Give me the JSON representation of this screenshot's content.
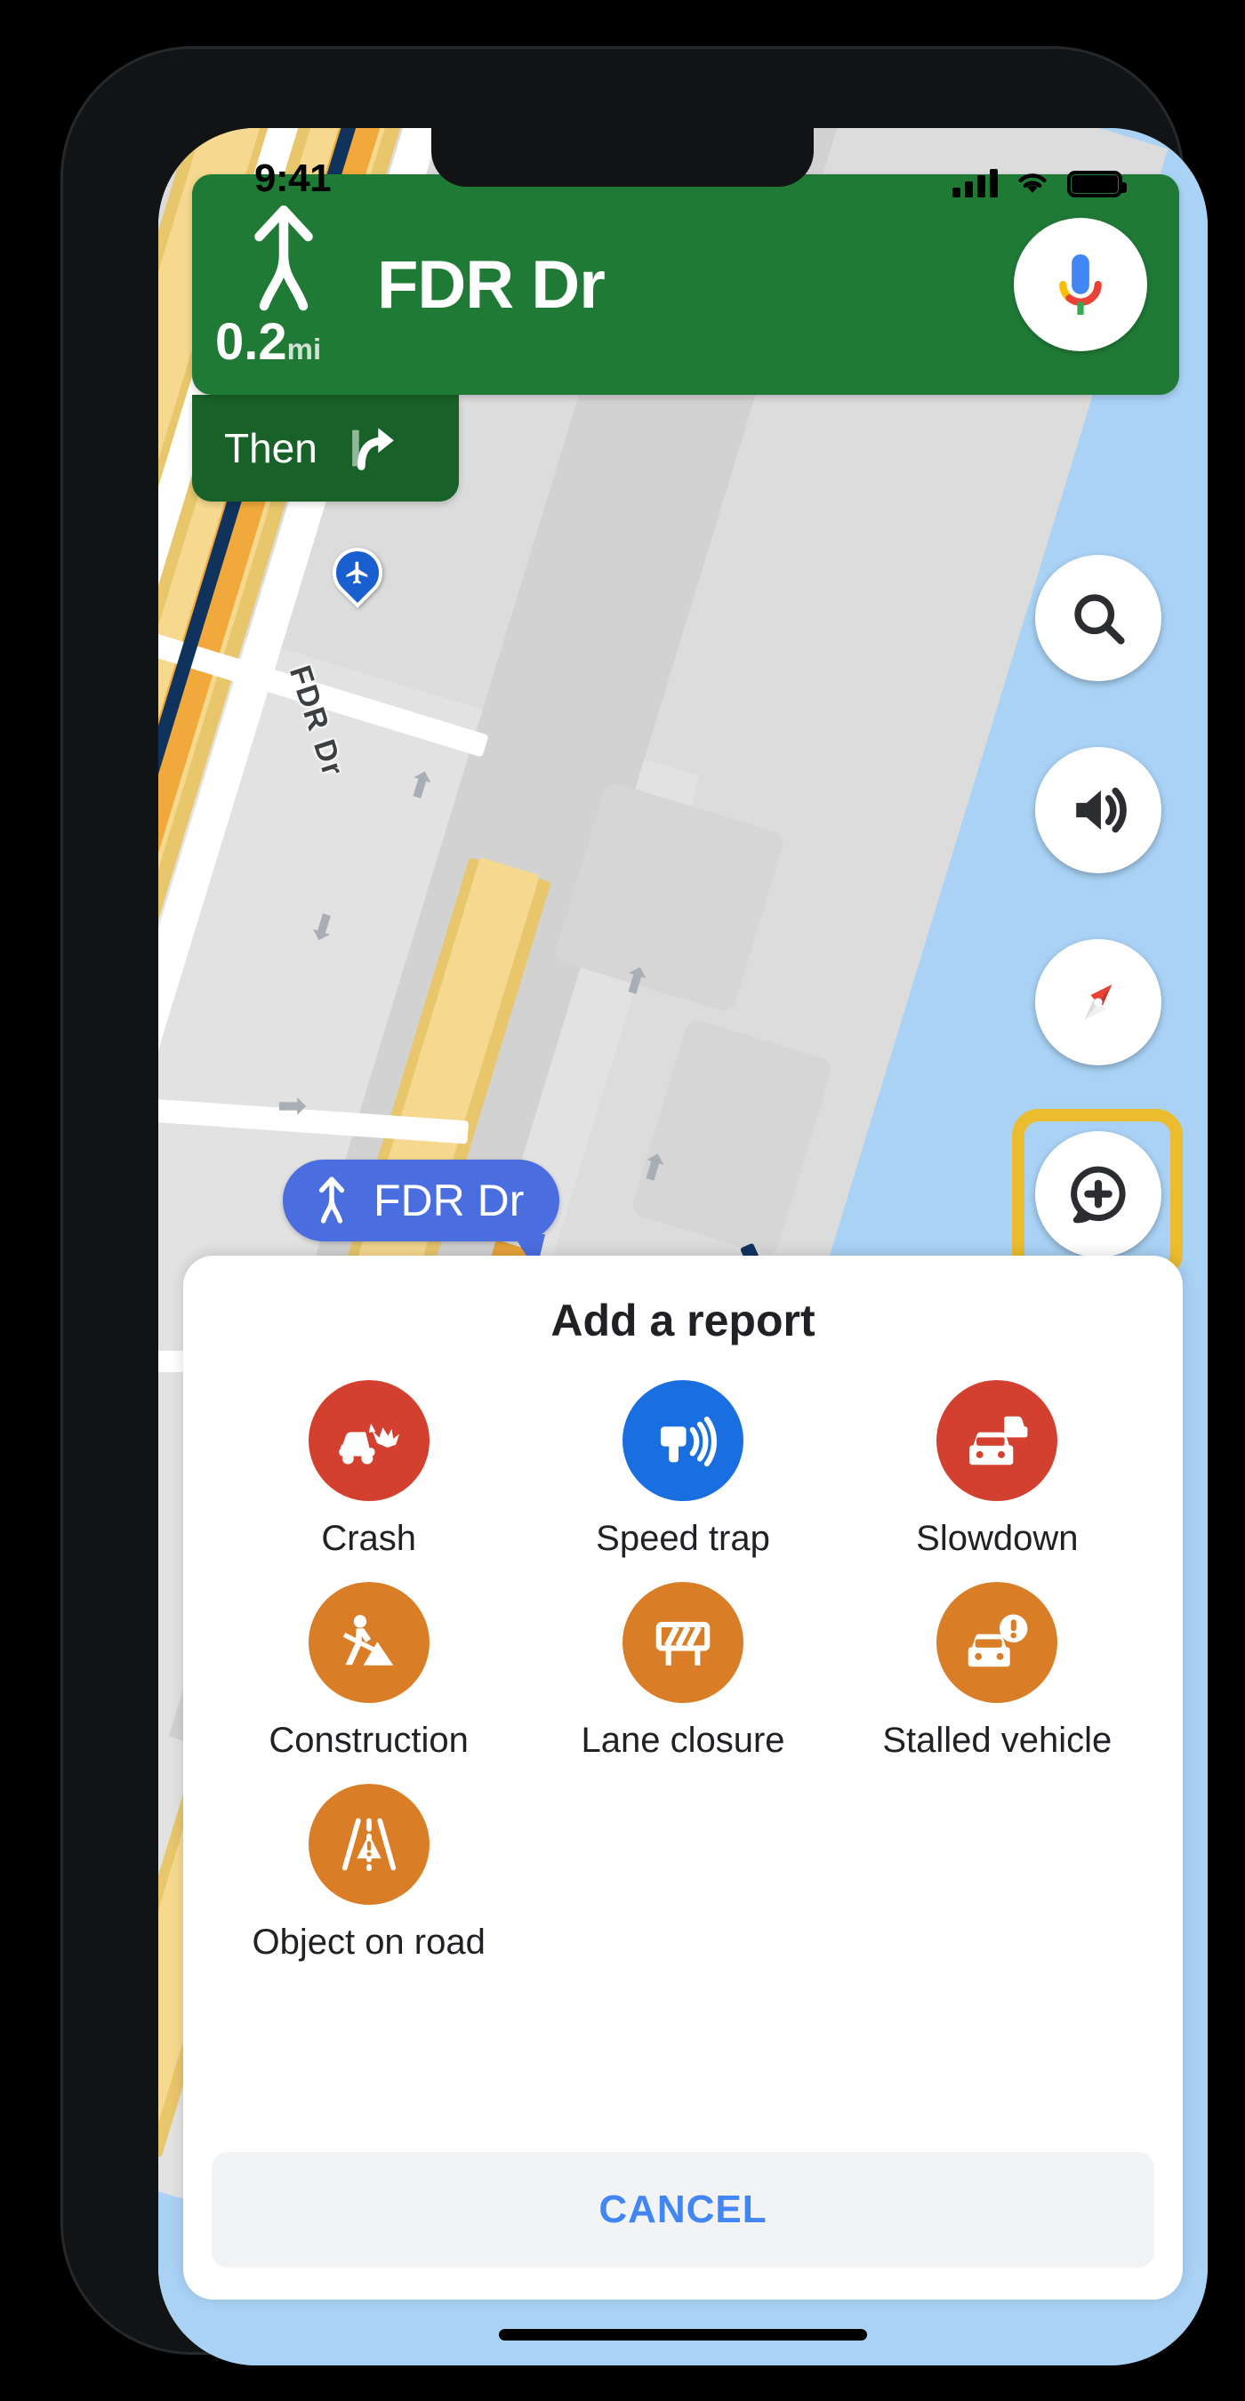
{
  "status_bar": {
    "time": "9:41",
    "signal_icon": "cellular-signal-icon",
    "wifi_icon": "wifi-icon",
    "battery_icon": "battery-full-icon"
  },
  "navigation": {
    "maneuver_icon": "merge-straight-arrow-icon",
    "distance_value": "0.2",
    "distance_unit": "mi",
    "street": "FDR Dr",
    "assistant_icon": "google-assistant-mic-icon",
    "then": {
      "label": "Then",
      "icon": "turn-right-arrow-icon"
    }
  },
  "map": {
    "callout": {
      "icon": "merge-straight-arrow-icon",
      "label": "FDR Dr"
    },
    "road_label": "FDR Dr",
    "airport_pin_icon": "airport-plane-icon",
    "colors": {
      "water": "#a9d2f5",
      "land": "#dcdcdc",
      "highway": "#f6d98f",
      "traffic_slow": "#f2a93b",
      "route": "#10335e"
    }
  },
  "map_controls": [
    {
      "name": "search",
      "icon": "search-icon"
    },
    {
      "name": "volume",
      "icon": "volume-up-icon"
    },
    {
      "name": "compass",
      "icon": "compass-icon"
    },
    {
      "name": "add-report",
      "icon": "add-report-bubble-icon",
      "highlighted": true,
      "highlight_color": "#ebbc2e"
    }
  ],
  "report_sheet": {
    "title": "Add a report",
    "items": [
      {
        "label": "Crash",
        "icon": "car-crash-icon",
        "color": "#d3402f"
      },
      {
        "label": "Speed trap",
        "icon": "speed-camera-icon",
        "color": "#1a6fe0"
      },
      {
        "label": "Slowdown",
        "icon": "traffic-jam-icon",
        "color": "#d3402f"
      },
      {
        "label": "Construction",
        "icon": "road-work-icon",
        "color": "#d97e26"
      },
      {
        "label": "Lane closure",
        "icon": "barricade-icon",
        "color": "#d97e26"
      },
      {
        "label": "Stalled vehicle",
        "icon": "stalled-car-icon",
        "color": "#d97e26"
      },
      {
        "label": "Object on road",
        "icon": "object-on-road-icon",
        "color": "#d97e26"
      }
    ],
    "cancel_label": "CANCEL"
  }
}
